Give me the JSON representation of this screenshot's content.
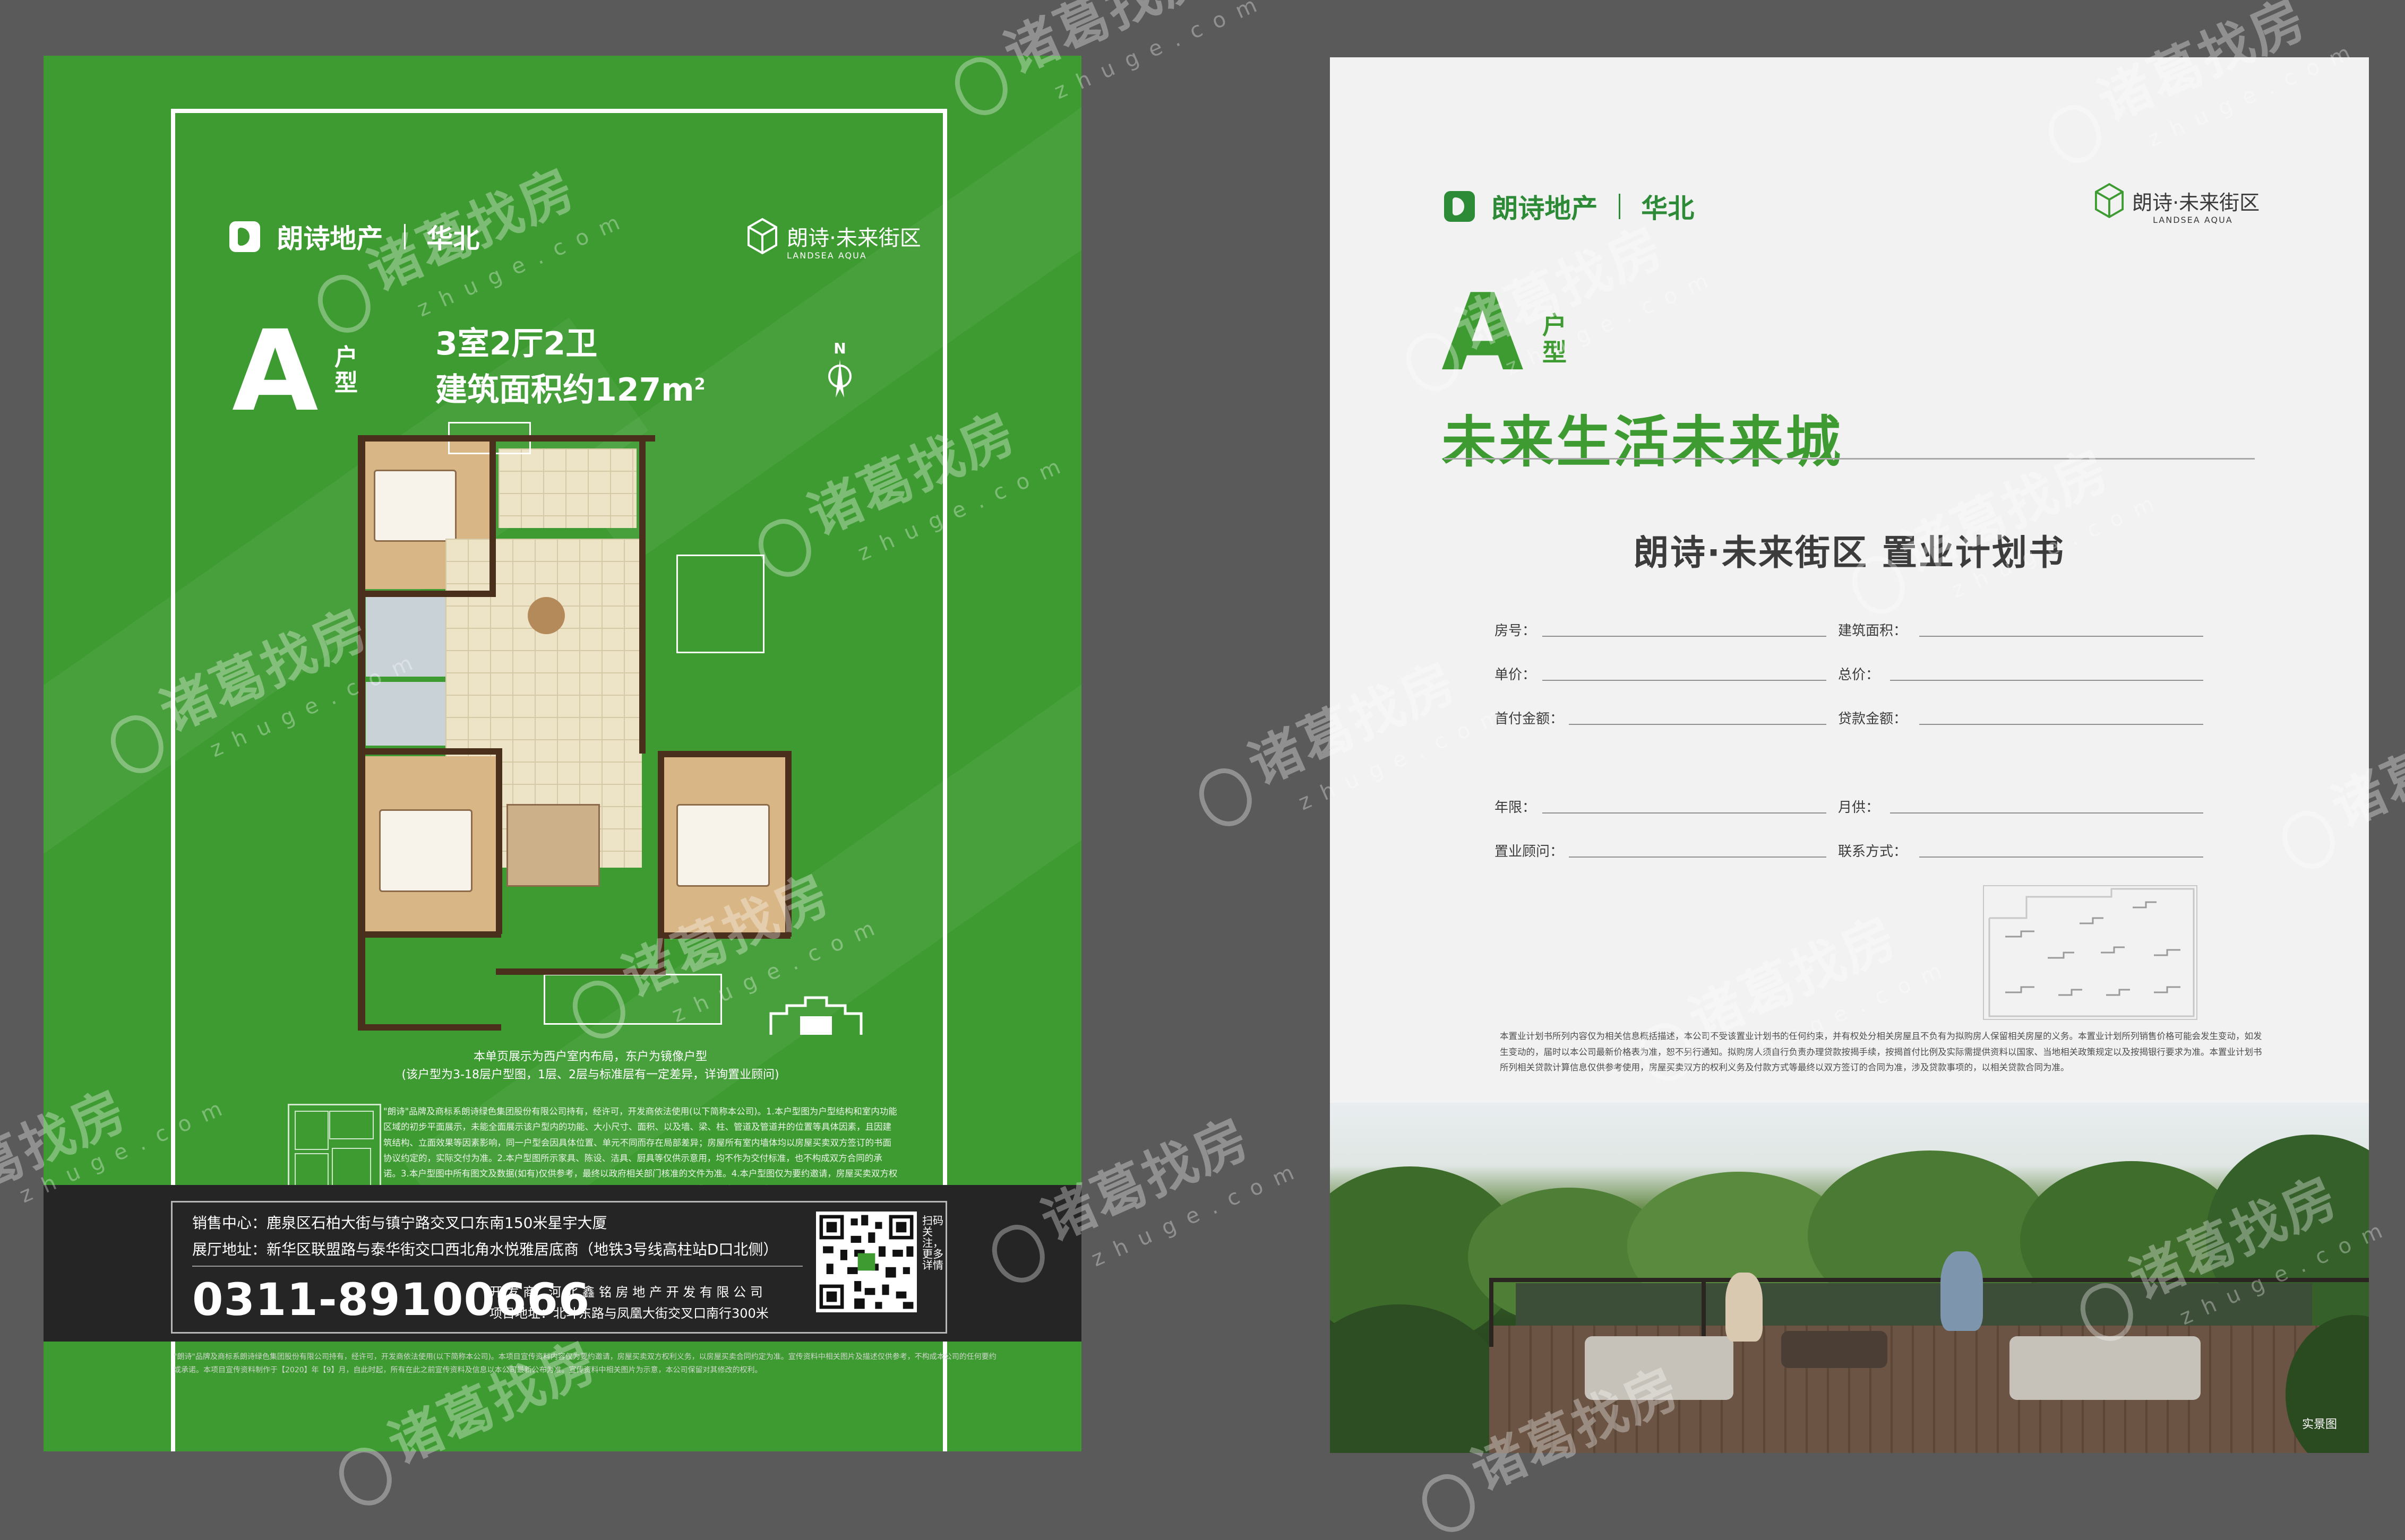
{
  "left_flyer": {
    "brand": "朗诗地产",
    "region": "华北",
    "project_name": "朗诗·未来街区",
    "project_en": "LANDSEA AQUA",
    "unit_letter": "A",
    "unit_type_label": "户型",
    "rooms": "3室2厅2卫",
    "area_text": "建筑面积约127m",
    "area_sup": "2",
    "compass": "N",
    "plan_note_1": "本单页展示为西户室内布局，东户为镜像户型",
    "plan_note_2": "(该户型为3-18层户型图，1层、2层与标准层有一定差异，详询置业顾问)",
    "disclaimer": "\"朗诗\"品牌及商标系朗诗绿色集团股份有限公司持有，经许可，开发商依法使用(以下简称本公司)。1.本户型图为户型结构和室内功能区域的初步平面展示，未能全面展示该户型内的功能、大小尺寸、面积、以及墙、梁、柱、管道及管道井的位置等具体因素，且因建筑结构、立面效果等因素影响，同一户型会因具体位置、单元不同而存在局部差异；房屋所有室内墙体均以房屋买卖双方签订的书面协议约定的，实际交付为准。2.本户型图所示家具、陈设、洁具、厨具等仅供示意用，均不作为交付标准，也不构成双方合同的承诺。3.本户型图中所有图文及数据(如有)仅供参考，最终以政府相关部门核准的文件为准。4.本户型图仅为要约邀请，房屋买卖双方权利义务，具体户型以最终备案合同附图为准。本公司保留对本户型图修改的权利，敬请留意最新资料",
    "sales_center": "销售中心：鹿泉区石柏大街与镇宁路交叉口东南150米星宇大厦",
    "showroom": "展厅地址：新华区联盟路与泰华街交口西北角水悦雅居底商（地铁3号线高柱站D口北侧）",
    "hotline": "0311-89100666",
    "developer": "开 发 商：河 北 鑫 铭 房 地 产 开 发 有 限 公 司",
    "project_address": "项目地址：北斗东路与凤凰大街交叉口南行300米",
    "qr_caption": "扫码关注，更多详情",
    "footer": "\"朗诗\"品牌及商标系朗诗绿色集团股份有限公司持有，经许可，开发商依法使用(以下简称本公司)。本项目宣传资料内容仅为要约邀请，房屋买卖双方权利义务，以房屋买卖合同约定为准。宣传资料中相关图片及描述仅供参考，不构成本公司的任何要约或承诺。本项目宣传资料制作于【2020】年【9】月，自此时起，所有在此之前宣传资料及信息以本公司最新公布为准。宣传资料中相关图片为示意，本公司保留对其修改的权利。"
  },
  "right_flyer": {
    "brand": "朗诗地产",
    "region": "华北",
    "project_name": "朗诗·未来街区",
    "project_en": "LANDSEA AQUA",
    "unit_letter": "A",
    "unit_type_label": "户型",
    "slogan": "未来生活未来城",
    "title": "朗诗·未来街区  置业计划书",
    "fields": [
      {
        "label": "房号："
      },
      {
        "label": "建筑面积："
      },
      {
        "label": "单价："
      },
      {
        "label": "总价："
      },
      {
        "label": "首付金额："
      },
      {
        "label": "贷款金额："
      },
      {
        "label": "年限："
      },
      {
        "label": "月供："
      },
      {
        "label": "置业顾问："
      },
      {
        "label": "联系方式："
      }
    ],
    "note": "本置业计划书所列内容仅为相关信息概括描述，本公司不受该置业计划书的任何约束，并有权处分相关房屋且不负有为拟购房人保留相关房屋的义务。本置业计划所列销售价格可能会发生变动，如发生变动的，届时以本公司最新价格表为准，恕不另行通知。拟购房人须自行负责办理贷款按揭手续，按揭首付比例及实际需提供资料以国家、当地相关政策规定以及按揭银行要求为准。本置业计划书所列相关贷款计算信息仅供参考使用，房屋买卖双方的权利义务及付款方式等最终以双方签订的合同为准，涉及贷款事项的，以相关贷款合同为准。",
    "photo_tag": "实景图"
  },
  "watermark": {
    "main": "诸葛找房",
    "sub": "zhuge.com"
  },
  "colors": {
    "green": "#3e9b32",
    "dark_green": "#2d8a36",
    "background": "#5a5a5a",
    "contact_bar": "#252525"
  }
}
